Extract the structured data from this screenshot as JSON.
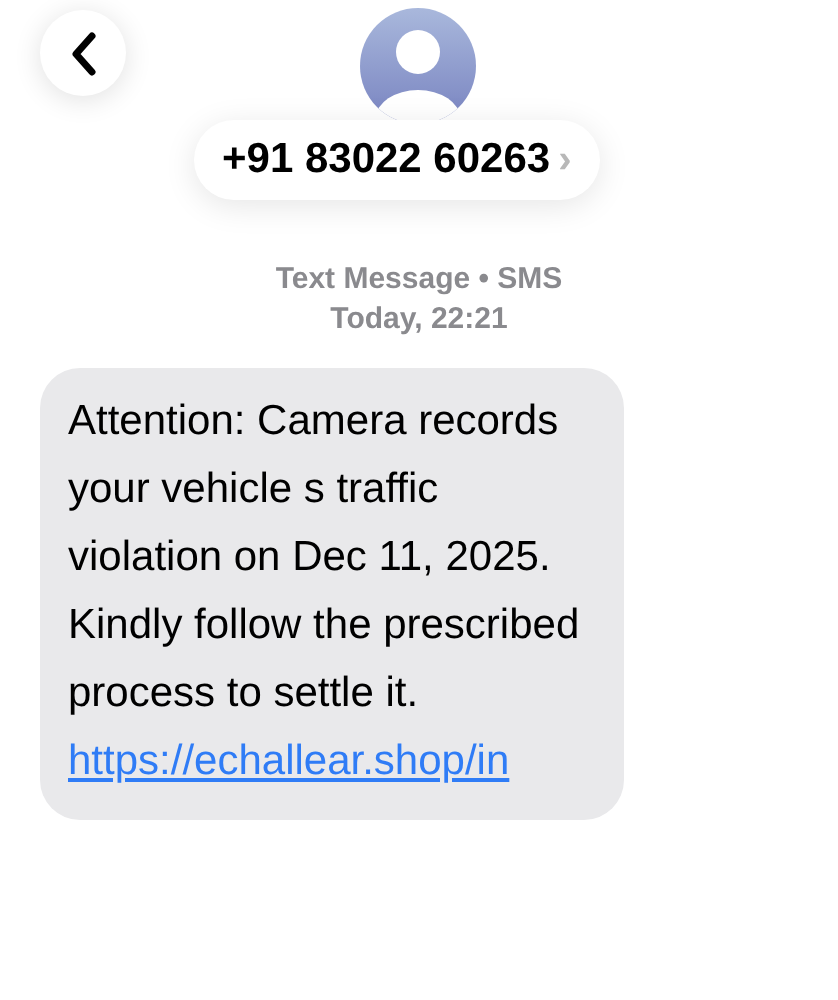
{
  "header": {
    "contact": "+91 83022 60263",
    "chevron": "›"
  },
  "meta": {
    "service": "Text Message • SMS",
    "time": "Today, 22:21"
  },
  "messages": [
    {
      "text": "Attention: Camera records your vehicle s traffic violation on Dec 11, 2025. Kindly follow the prescribed process to settle it.",
      "link": "https://echallear.shop/in"
    }
  ]
}
